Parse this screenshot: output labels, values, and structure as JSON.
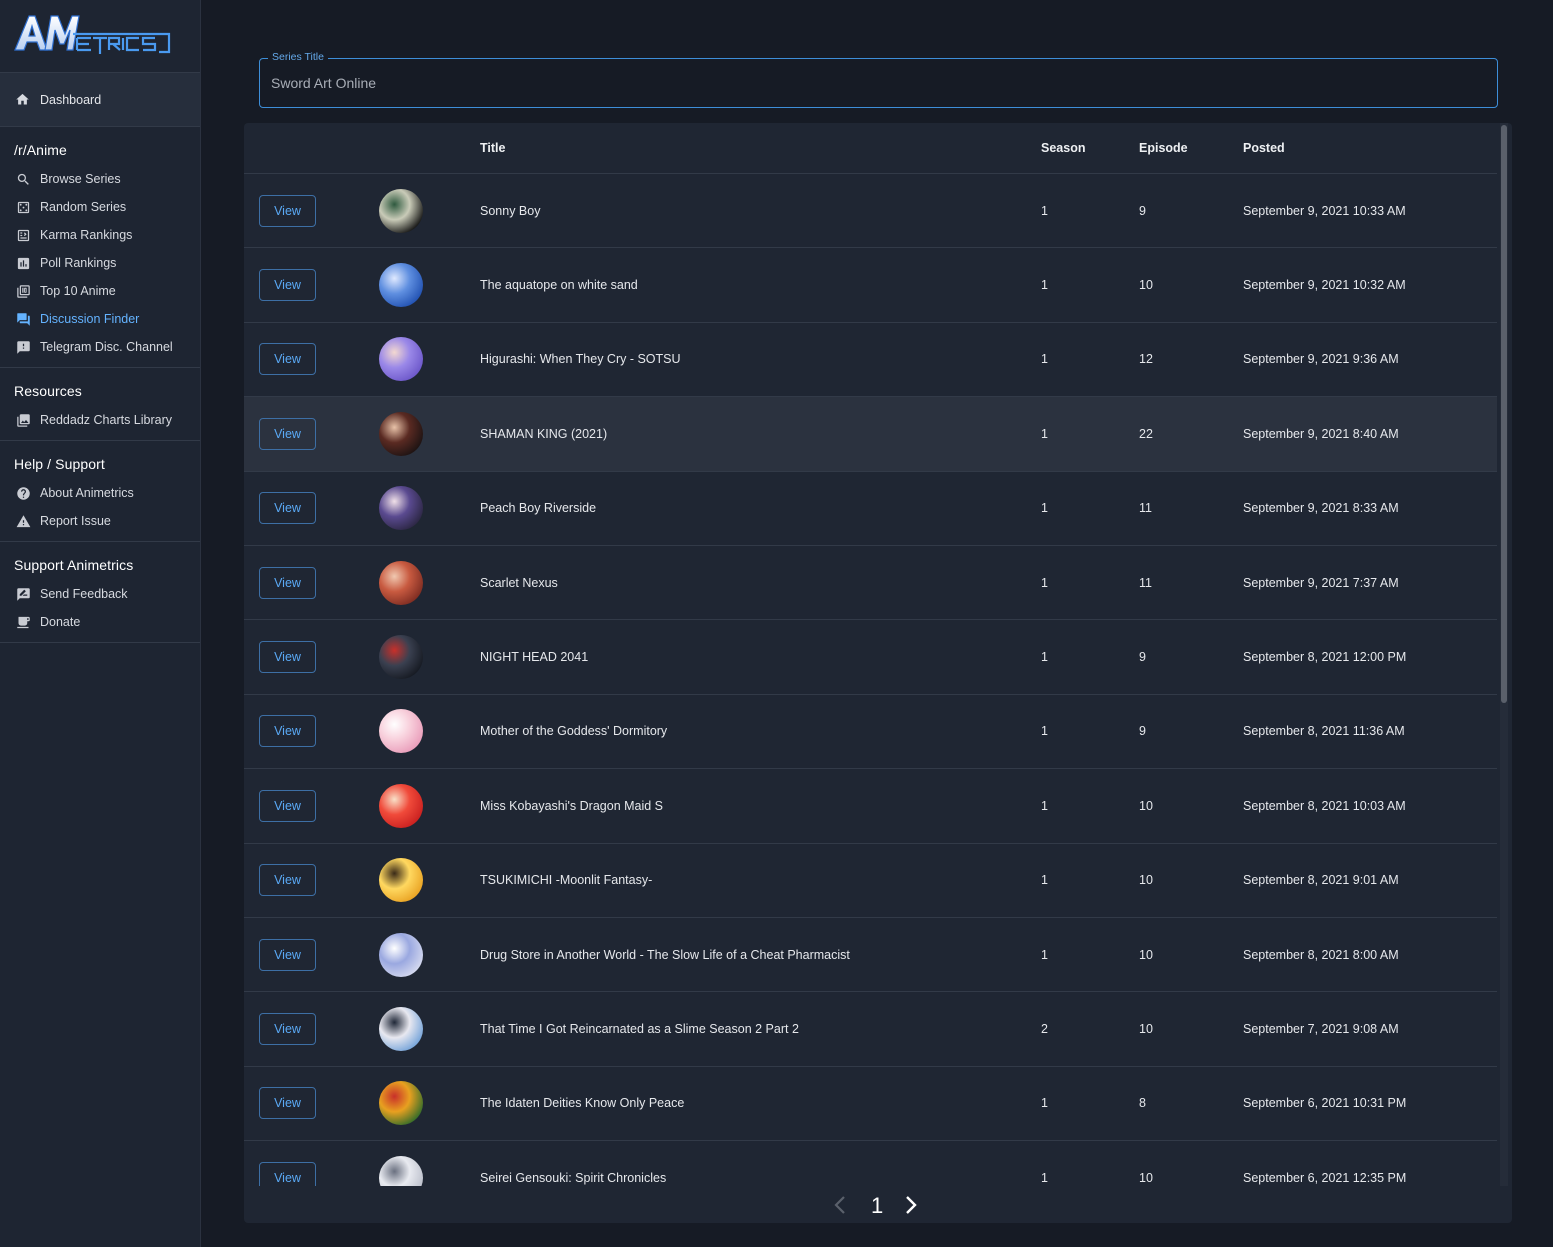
{
  "brand": {
    "logo_text": "AM ETRICS",
    "accent": "#3a8fe8"
  },
  "sidebar": {
    "dashboard": {
      "label": "Dashboard",
      "icon": "home-icon"
    },
    "sections": [
      {
        "title": "/r/Anime",
        "items": [
          {
            "label": "Browse Series",
            "icon": "search-icon",
            "active": false
          },
          {
            "label": "Random Series",
            "icon": "dice-icon",
            "active": false
          },
          {
            "label": "Karma Rankings",
            "icon": "karma-icon",
            "active": false
          },
          {
            "label": "Poll Rankings",
            "icon": "poll-icon",
            "active": false
          },
          {
            "label": "Top 10 Anime",
            "icon": "top10-icon",
            "active": false
          },
          {
            "label": "Discussion Finder",
            "icon": "forum-icon",
            "active": true
          },
          {
            "label": "Telegram Disc. Channel",
            "icon": "feedback-icon",
            "active": false
          }
        ]
      },
      {
        "title": "Resources",
        "items": [
          {
            "label": "Reddadz Charts Library",
            "icon": "library-icon",
            "active": false
          }
        ]
      },
      {
        "title": "Help / Support",
        "items": [
          {
            "label": "About Animetrics",
            "icon": "help-icon",
            "active": false
          },
          {
            "label": "Report Issue",
            "icon": "warning-icon",
            "active": false
          }
        ]
      },
      {
        "title": "Support Animetrics",
        "items": [
          {
            "label": "Send Feedback",
            "icon": "rate-review-icon",
            "active": false
          },
          {
            "label": "Donate",
            "icon": "coffee-icon",
            "active": false
          }
        ]
      }
    ]
  },
  "search": {
    "label": "Series Title",
    "value": "Sword Art Online"
  },
  "table": {
    "columns": [
      "",
      "",
      "Title",
      "Season",
      "Episode",
      "Posted"
    ],
    "view_label": "View",
    "rows": [
      {
        "title": "Sonny Boy",
        "season": "1",
        "episode": "9",
        "posted": "September 9, 2021 10:33 AM",
        "avatar": [
          "#0c0c0c",
          "#c9cbb8",
          "#2f5a3f"
        ]
      },
      {
        "title": "The aquatope on white sand",
        "season": "1",
        "episode": "10",
        "posted": "September 9, 2021 10:32 AM",
        "avatar": [
          "#1f4fb0",
          "#5f8fe0",
          "#dfe9ff"
        ]
      },
      {
        "title": "Higurashi: When They Cry - SOTSU",
        "season": "1",
        "episode": "12",
        "posted": "September 9, 2021 9:36 AM",
        "avatar": [
          "#6a55c8",
          "#9a88e8",
          "#f3d8d0"
        ]
      },
      {
        "title": "SHAMAN KING (2021)",
        "season": "1",
        "episode": "22",
        "posted": "September 9, 2021 8:40 AM",
        "avatar": [
          "#1a1212",
          "#5a2a22",
          "#e8c2a8"
        ]
      },
      {
        "title": "Peach Boy Riverside",
        "season": "1",
        "episode": "11",
        "posted": "September 9, 2021 8:33 AM",
        "avatar": [
          "#2a2540",
          "#5a4a90",
          "#f0e0e8"
        ]
      },
      {
        "title": "Scarlet Nexus",
        "season": "1",
        "episode": "11",
        "posted": "September 9, 2021 7:37 AM",
        "avatar": [
          "#7a2a20",
          "#c85a40",
          "#f0c8b0"
        ]
      },
      {
        "title": "NIGHT HEAD 2041",
        "season": "1",
        "episode": "9",
        "posted": "September 8, 2021 12:00 PM",
        "avatar": [
          "#141820",
          "#3a4050",
          "#c8302a"
        ]
      },
      {
        "title": "Mother of the Goddess' Dormitory",
        "season": "1",
        "episode": "9",
        "posted": "September 8, 2021 11:36 AM",
        "avatar": [
          "#e89ab8",
          "#f8d0dc",
          "#ffffff"
        ]
      },
      {
        "title": "Miss Kobayashi's Dragon Maid S",
        "season": "1",
        "episode": "10",
        "posted": "September 8, 2021 10:03 AM",
        "avatar": [
          "#c81e1e",
          "#f04a3a",
          "#f8e0c8"
        ]
      },
      {
        "title": "TSUKIMICHI -Moonlit Fantasy-",
        "season": "1",
        "episode": "10",
        "posted": "September 8, 2021 9:01 AM",
        "avatar": [
          "#e8a020",
          "#ffd860",
          "#3a2a18"
        ]
      },
      {
        "title": "Drug Store in Another World - The Slow Life of a Cheat Pharmacist",
        "season": "1",
        "episode": "10",
        "posted": "September 8, 2021 8:00 AM",
        "avatar": [
          "#d8dcf0",
          "#9aa8e0",
          "#ffffff"
        ]
      },
      {
        "title": "That Time I Got Reincarnated as a Slime Season 2 Part 2",
        "season": "2",
        "episode": "10",
        "posted": "September 7, 2021 9:08 AM",
        "avatar": [
          "#6fa0d8",
          "#e8e8f0",
          "#202838"
        ]
      },
      {
        "title": "The Idaten Deities Know Only Peace",
        "season": "1",
        "episode": "8",
        "posted": "September 6, 2021 10:31 PM",
        "avatar": [
          "#2a6a2a",
          "#e8a020",
          "#c8302a"
        ]
      },
      {
        "title": "Seirei Gensouki: Spirit Chronicles",
        "season": "1",
        "episode": "10",
        "posted": "September 6, 2021 12:35 PM",
        "avatar": [
          "#b8bcc8",
          "#e8eaf0",
          "#6a7080"
        ]
      }
    ]
  },
  "pagination": {
    "current_page": "1"
  }
}
